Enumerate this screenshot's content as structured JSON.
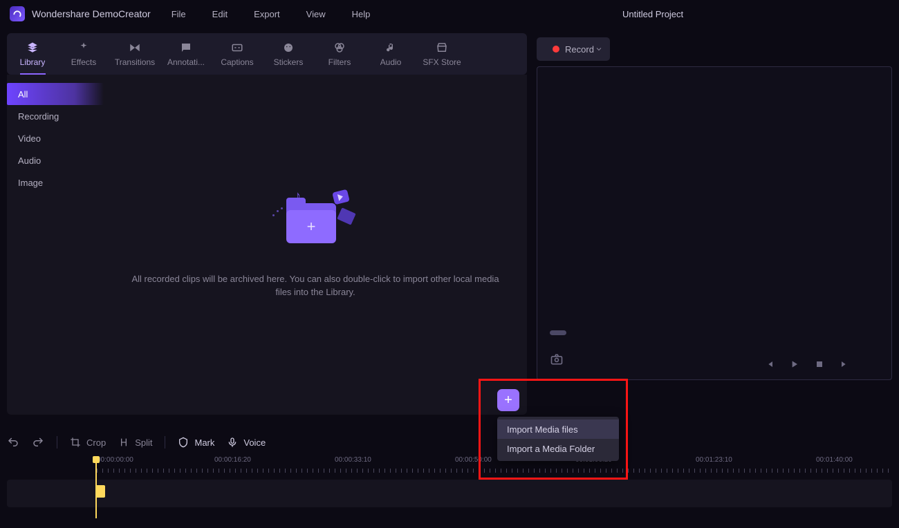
{
  "app": {
    "title": "Wondershare DemoCreator",
    "project": "Untitled Project"
  },
  "menubar": {
    "file": "File",
    "edit": "Edit",
    "export": "Export",
    "view": "View",
    "help": "Help"
  },
  "tooltabs": {
    "library": "Library",
    "effects": "Effects",
    "transitions": "Transitions",
    "annotations": "Annotati...",
    "captions": "Captions",
    "stickers": "Stickers",
    "filters": "Filters",
    "audio": "Audio",
    "sfx": "SFX Store"
  },
  "library": {
    "cats": {
      "all": "All",
      "recording": "Recording",
      "video": "Video",
      "audio": "Audio",
      "image": "Image"
    },
    "empty_text": "All recorded clips will be archived here. You can also double-click to import other local media files into the Library."
  },
  "record": {
    "label": "Record"
  },
  "context_menu": {
    "import_files": "Import Media files",
    "import_folder": "Import a Media Folder"
  },
  "timeline_toolbar": {
    "crop": "Crop",
    "split": "Split",
    "mark": "Mark",
    "voice": "Voice"
  },
  "ruler": {
    "t0": "00:00:00:00",
    "t1": "00:00:16:20",
    "t2": "00:00:33:10",
    "t3": "00:00:50:00",
    "t4": "00:01:06:20",
    "t5": "00:01:23:10",
    "t6": "00:01:40:00"
  }
}
